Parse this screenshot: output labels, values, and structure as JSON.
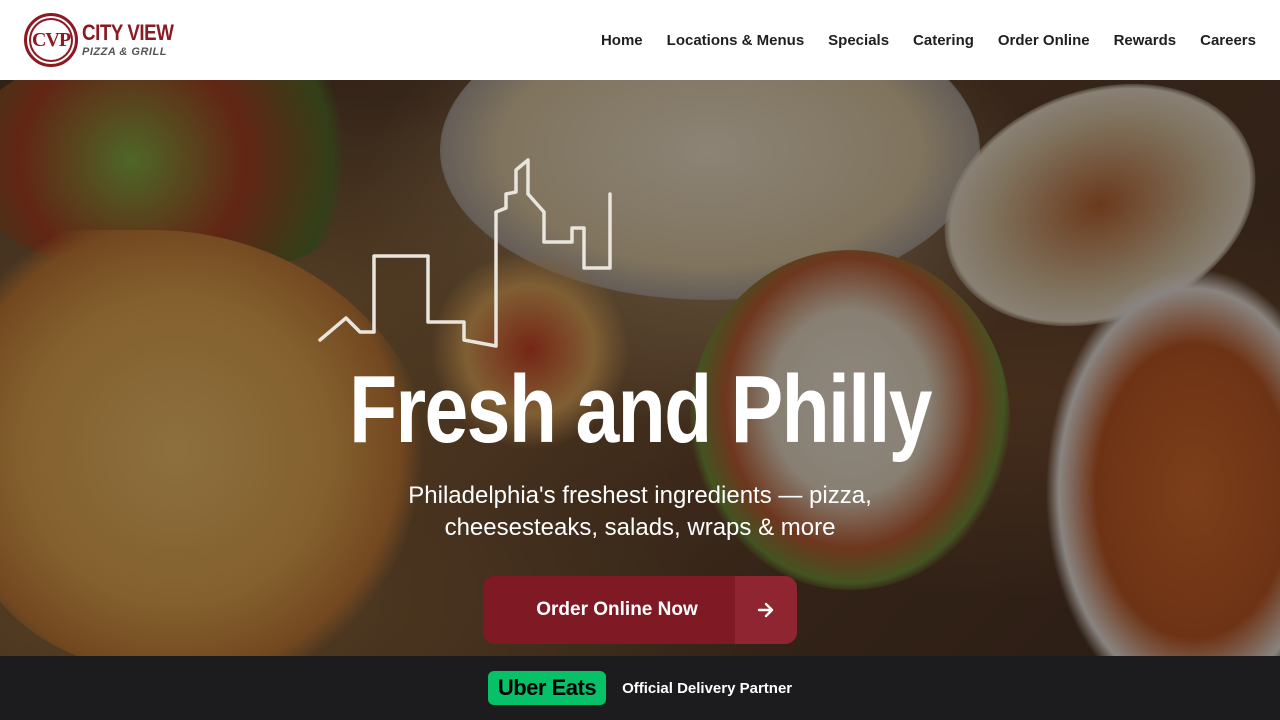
{
  "header": {
    "logo": {
      "badge": "CVP",
      "title": "CITY VIEW",
      "subtitle": "PIZZA & GRILL"
    },
    "nav": [
      {
        "label": "Home"
      },
      {
        "label": "Locations & Menus"
      },
      {
        "label": "Specials"
      },
      {
        "label": "Catering"
      },
      {
        "label": "Order Online"
      },
      {
        "label": "Rewards"
      },
      {
        "label": "Careers"
      }
    ]
  },
  "hero": {
    "title": "Fresh and Philly",
    "subtitle": "Philadelphia's freshest ingredients — pizza, cheesesteaks, salads, wraps & more",
    "cta_label": "Order Online Now",
    "cta_icon": "arrow-right-icon",
    "decoration_icon": "skyline-icon"
  },
  "bottom_bar": {
    "brand": "Uber Eats",
    "text": "Official Delivery Partner"
  },
  "colors": {
    "brand_red": "#7f1a24",
    "uber_green": "#06c167",
    "bar_dark": "#1c1c1e"
  }
}
